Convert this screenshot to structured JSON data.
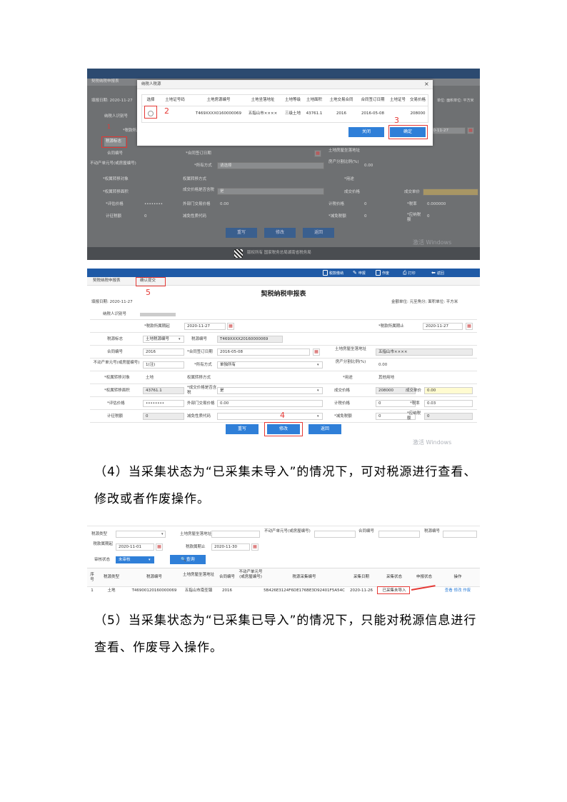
{
  "shot1": {
    "toolbar": [
      "税款缴纳",
      "申报",
      "作废",
      "打印",
      "返回"
    ],
    "sub_tab": "契税纳税申报表",
    "fill_date": "填报日期: 2020-11-27",
    "units": "金额单位: 元至角分;  面积单位: 平方米",
    "units_short": "单位:  面积单位:  平方米",
    "field_labels": [
      "纳税人识别号",
      "*税款所属期止",
      "税源标志",
      "合同编号",
      "*合同签订日期",
      "土地房屋坐落地址",
      "不动产单元号(或房屋编号)",
      "*所有方式",
      "房产分割比例(%)",
      "*权属转移对象",
      "权属转移方式",
      "*用途",
      "*权属转移面积",
      "成交价格是否含税",
      "成交价格",
      "成交单价",
      "*评估价格",
      "外部门交易价格",
      "计税价格",
      "*税率",
      "计征税额",
      "减免性质代码",
      "*减免税额"
    ],
    "values": {
      "fill_date_val": "2020-11-27",
      "select_all": "请选择",
      "ratio": "0.00",
      "yes": "是",
      "price": "0.00",
      "price2": "0.000000",
      "zero": "0",
      "pwd": "••••••••"
    },
    "buttons": [
      "重写",
      "修改",
      "返回"
    ],
    "footer": "版权所有  国家税务总局湖南省税务局",
    "watermark": "激活 Windows",
    "dialog": {
      "title": "纳税人税源",
      "headers": [
        "选择",
        "土地证号码",
        "土地房源编号",
        "土地坐落地址",
        "土地等级",
        "土地面积",
        "土地交易合同",
        "合同签订日期",
        "土地证号",
        "交易价格"
      ],
      "row": [
        "○",
        "",
        "T469XXXX0160000069",
        "五指山市××××",
        "三级土地",
        "43761.1",
        "2016",
        "2016-05-08",
        "",
        "208000"
      ],
      "buttons": [
        "关闭",
        "确定"
      ],
      "close": "×"
    },
    "side_btn": "税源标志",
    "markers": [
      "1",
      "2",
      "3"
    ]
  },
  "shot2": {
    "toolbar": [
      "税款缴纳",
      "申报",
      "作废",
      "打印",
      "返回"
    ],
    "tabs": [
      "契税纳税申报表",
      "确认提交"
    ],
    "title": "契税纳税申报表",
    "fill_date": "填报日期: 2020-11-27",
    "units": "金额单位: 元至角分;  面积单位: 平方米",
    "rows": {
      "r1": {
        "l1": "纳税人识别号"
      },
      "r2": {
        "l1": "*税款所属期起",
        "v1": "2020-11-27",
        "l2": "*税款所属期止",
        "v2": "2020-11-27"
      },
      "r3": {
        "l1": "税源标志",
        "v1": "土地税源编号",
        "l2": "税源编号",
        "v2": "T469XXXX20160000069"
      },
      "r4": {
        "l1": "合同编号",
        "v1": "2016",
        "l2": "*合同签订日期",
        "v2": "2016-05-08",
        "l3": "土地房屋坐落地址",
        "v3": "五指山市××××"
      },
      "r5": {
        "l1": "不动产单元号(或房屋编号)",
        "v1": "1(注)",
        "l2": "*所有方式",
        "v2": "单独所有",
        "l3": "房产分割比例(%)",
        "v3": "0.00"
      },
      "r6": {
        "l1": "*权属转移对象",
        "v1": "土地",
        "l2": "权属转移方式",
        "l3": "*用途",
        "v3": "其他用地"
      },
      "r7": {
        "l1": "*权属转移面积",
        "v1": "43761.1",
        "l2": "*成交价格是否含税",
        "v2": "是",
        "l3": "成交价格",
        "v3": "208000",
        "l4": "成交单价",
        "v4": "0.00"
      },
      "r8": {
        "l1": "*评估价格",
        "v1": "••••••••",
        "l2": "外部门交易价格",
        "v2": "0.00",
        "l3": "计税价格",
        "v3": "0",
        "l4": "*税率",
        "v4": "0.03"
      },
      "r9": {
        "l1": "计征税额",
        "v1": "0",
        "l2": "减免性质代码",
        "l3": "*减免税额",
        "v3": "0",
        "l4": "*应纳税额",
        "v4": "0"
      }
    },
    "buttons": [
      "重写",
      "修改",
      "返回"
    ],
    "markers": [
      "4",
      "5"
    ],
    "watermark": "激活 Windows"
  },
  "para4": "（4）当采集状态为“已采集未导入”的情况下，可对税源进行查看、修改或者作废操作。",
  "shot3": {
    "filter_labels": [
      "税源类型",
      "土地房屋坐落地址",
      "不动产单元号(或房屋编号)",
      "合同编号",
      "税源编号",
      "税款属期起",
      "税款属期止",
      "审核状态"
    ],
    "dates": [
      "2020-11-01",
      "2020-11-30"
    ],
    "status_val": "未审核",
    "query": "查询",
    "headers": [
      "序号",
      "税源类型",
      "税源编号",
      "土地房屋坐落地址",
      "合同编号",
      "不动产单元号(或房屋编号)",
      "税源采集编号",
      "采集日期",
      "采集状态",
      "申报状态",
      "操作"
    ],
    "row": [
      "1",
      "土地",
      "T46900120160000069",
      "五指山市南圣镇",
      "2016",
      "",
      "5B426E3124F6DE176BE3D92401F5A54C",
      "2020-11-26",
      "已采集未导入",
      "",
      "查看 修改 作废"
    ]
  },
  "para5": "（5）当采集状态为“已采集已导入”的情况下，只能对税源信息进行查看、作废导入操作。"
}
